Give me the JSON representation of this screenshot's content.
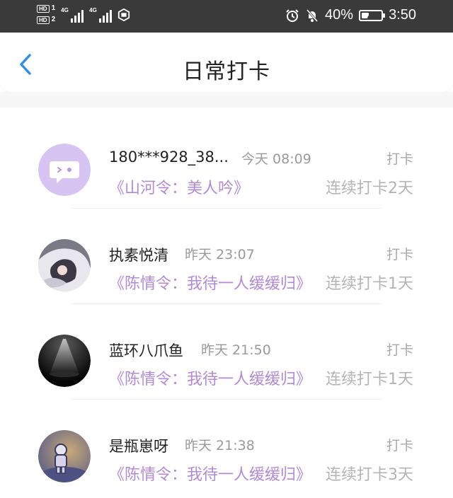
{
  "status_bar": {
    "hd1": "HD",
    "hd1_num": "1",
    "hd2": "HD",
    "hd2_num": "2",
    "net1": "4G",
    "net2": "4G",
    "battery_text": "40%",
    "battery_level": 0.4,
    "time": "3:50"
  },
  "header": {
    "title": "日常打卡"
  },
  "colors": {
    "accent_blue": "#2f8fe8",
    "book_purple": "#b08ad8"
  },
  "list": [
    {
      "name": "180***928_38...",
      "time": "今天 08:09",
      "checkin_label": "打卡",
      "book": "《山河令：美人吟》",
      "streak": "连续打卡2天",
      "avatar_icon": "chat-bubble-face-icon"
    },
    {
      "name": "执素悦清",
      "time": "昨天 23:07",
      "checkin_label": "打卡",
      "book": "《陈情令：我待一人缓缓归》",
      "streak": "连续打卡1天",
      "avatar_icon": "anime-character-avatar"
    },
    {
      "name": "蓝环八爪鱼",
      "time": "昨天 21:50",
      "checkin_label": "打卡",
      "book": "《陈情令：我待一人缓缓归》",
      "streak": "连续打卡1天",
      "avatar_icon": "spotlight-avatar"
    },
    {
      "name": "是瓶崽呀",
      "time": "昨天 21:38",
      "checkin_label": "打卡",
      "book": "《陈情令：我待一人缓缓归》",
      "streak": "连续打卡3天",
      "avatar_icon": "astronaut-avatar"
    }
  ]
}
